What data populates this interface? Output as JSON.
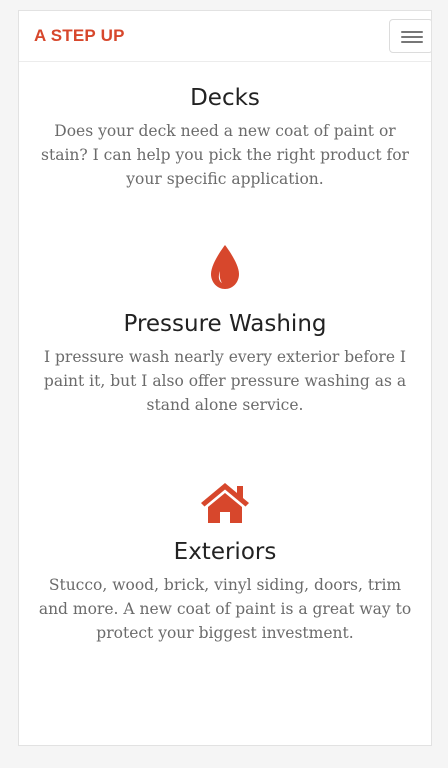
{
  "navbar": {
    "brand": "A STEP UP"
  },
  "accent_color": "#d7472c",
  "services": [
    {
      "icon": "paint-drop-icon",
      "title": "Decks",
      "description": "Does your deck need a new coat of paint or stain? I can help you pick the right product for your specific application."
    },
    {
      "icon": "water-drop-icon",
      "title": "Pressure Washing",
      "description": "I pressure wash nearly every exterior before I paint it, but I also offer pressure washing as a stand alone service."
    },
    {
      "icon": "house-icon",
      "title": "Exteriors",
      "description": "Stucco, wood, brick, vinyl siding, doors, trim and more. A new coat of paint is a great way to protect your biggest investment."
    }
  ]
}
